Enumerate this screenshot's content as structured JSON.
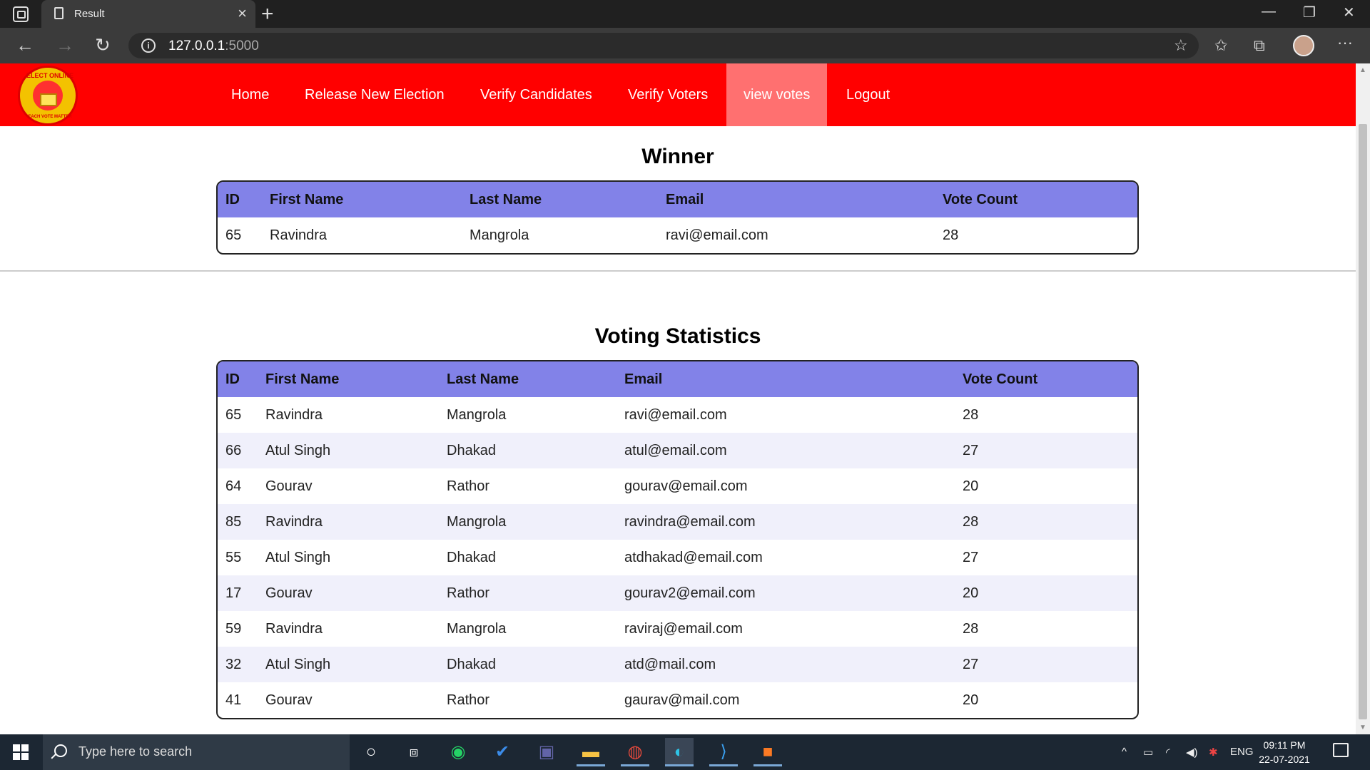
{
  "browser": {
    "tab_title": "Result",
    "url_host": "127.0.0.1",
    "url_port": ":5000"
  },
  "navbar": {
    "logo_text": "ELECT ONLINE",
    "logo_subtext": "EACH VOTE MATTER",
    "items": [
      {
        "label": "Home",
        "active": false
      },
      {
        "label": "Release New Election",
        "active": false
      },
      {
        "label": "Verify Candidates",
        "active": false
      },
      {
        "label": "Verify Voters",
        "active": false
      },
      {
        "label": "view votes",
        "active": true
      },
      {
        "label": "Logout",
        "active": false
      }
    ]
  },
  "winner": {
    "title": "Winner",
    "headers": [
      "ID",
      "First Name",
      "Last Name",
      "Email",
      "Vote Count"
    ],
    "rows": [
      [
        "65",
        "Ravindra",
        "Mangrola",
        "ravi@email.com",
        "28"
      ]
    ]
  },
  "stats": {
    "title": "Voting Statistics",
    "headers": [
      "ID",
      "First Name",
      "Last Name",
      "Email",
      "Vote Count"
    ],
    "rows": [
      [
        "65",
        "Ravindra",
        "Mangrola",
        "ravi@email.com",
        "28"
      ],
      [
        "66",
        "Atul Singh",
        "Dhakad",
        "atul@email.com",
        "27"
      ],
      [
        "64",
        "Gourav",
        "Rathor",
        "gourav@email.com",
        "20"
      ],
      [
        "85",
        "Ravindra",
        "Mangrola",
        "ravindra@email.com",
        "28"
      ],
      [
        "55",
        "Atul Singh",
        "Dhakad",
        "atdhakad@email.com",
        "27"
      ],
      [
        "17",
        "Gourav",
        "Rathor",
        "gourav2@email.com",
        "20"
      ],
      [
        "59",
        "Ravindra",
        "Mangrola",
        "raviraj@email.com",
        "28"
      ],
      [
        "32",
        "Atul Singh",
        "Dhakad",
        "atd@mail.com",
        "27"
      ],
      [
        "41",
        "Gourav",
        "Rathor",
        "gaurav@mail.com",
        "20"
      ]
    ]
  },
  "taskbar": {
    "search_placeholder": "Type here to search",
    "language": "ENG",
    "time": "09:11 PM",
    "date": "22-07-2021"
  },
  "colors": {
    "navbar": "#ff0000",
    "nav_active": "#ff7070",
    "table_header": "#8282e8"
  }
}
